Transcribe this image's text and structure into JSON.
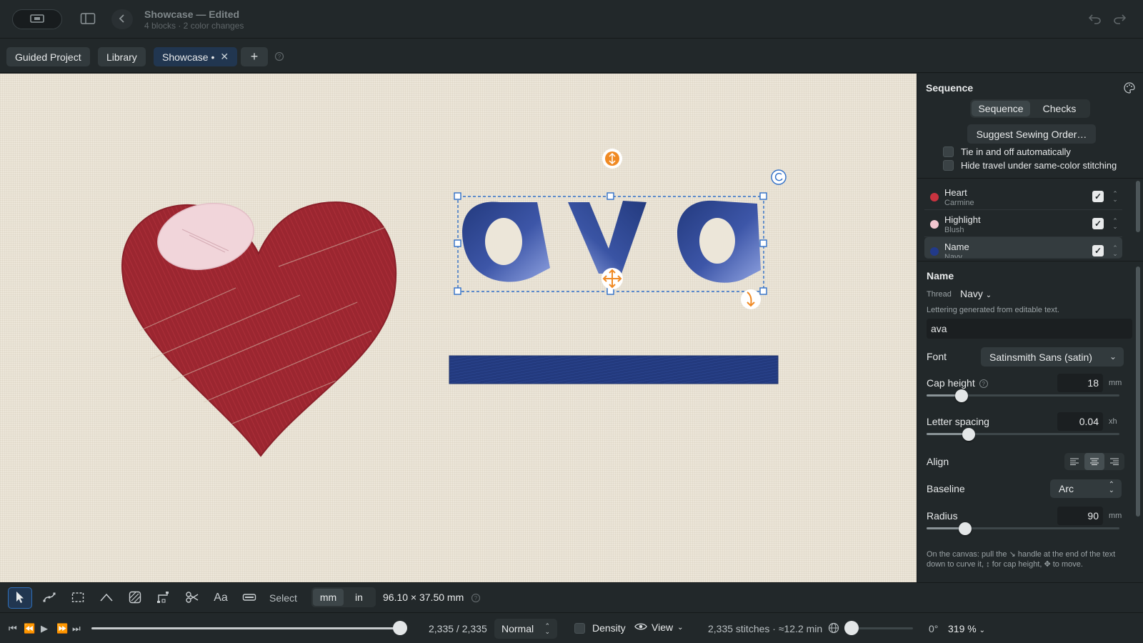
{
  "titlebar": {
    "title": "Showcase — Edited",
    "subtitle": "4 blocks · 2 color changes"
  },
  "tabs": [
    {
      "label": "Guided Project"
    },
    {
      "label": "Library"
    },
    {
      "label": "Showcase •"
    }
  ],
  "panel": {
    "title": "Sequence",
    "segments": [
      "Sequence",
      "Checks"
    ],
    "suggest_label": "Suggest Sewing Order…",
    "options": [
      "Tie in and off automatically",
      "Hide travel under same-color stitching"
    ],
    "items": [
      {
        "name": "Heart",
        "thread": "Carmine",
        "color": "#c8333f"
      },
      {
        "name": "Highlight",
        "thread": "Blush",
        "color": "#f2c6cf"
      },
      {
        "name": "Name",
        "thread": "Navy",
        "color": "#223a8a"
      }
    ]
  },
  "props": {
    "title": "Name",
    "thread_label": "Thread",
    "thread_value": "Navy",
    "hint": "Lettering generated from editable text.",
    "text_value": "ava",
    "font_label": "Font",
    "font_value": "Satinsmith Sans (satin)",
    "cap_label": "Cap height",
    "cap_value": "18",
    "cap_unit": "mm",
    "cap_level": 0.18,
    "spacing_label": "Letter spacing",
    "spacing_value": "0.04",
    "spacing_unit": "xh",
    "spacing_level": 0.22,
    "align_label": "Align",
    "align_active": "center",
    "baseline_label": "Baseline",
    "baseline_value": "Arc",
    "radius_label": "Radius",
    "radius_value": "90",
    "radius_unit": "mm",
    "radius_level": 0.2,
    "foot_hint": "On the canvas: pull the ↘ handle at the end of the text down to curve it, ↕ for cap height, ✥ to move."
  },
  "canvas": {
    "lettering": "ava",
    "heart_color": "#9b2630",
    "highlight_color": "#f1d5da",
    "navy_color": "#233a7e",
    "handle_color": "#f08a24",
    "selection_color": "#2f6fc8"
  },
  "toolbar": {
    "mode_label": "Select",
    "units": [
      "mm",
      "in"
    ],
    "active_unit": "mm",
    "dims": "96.10 × 37.50 mm"
  },
  "playbar": {
    "count": "2,335 / 2,335",
    "progress": 1.0,
    "mode": "Normal",
    "density_label": "Density",
    "view_label": "View",
    "stats": "2,335 stitches · ≈12.2 min",
    "angle": "0°",
    "zoom": "319 %"
  }
}
